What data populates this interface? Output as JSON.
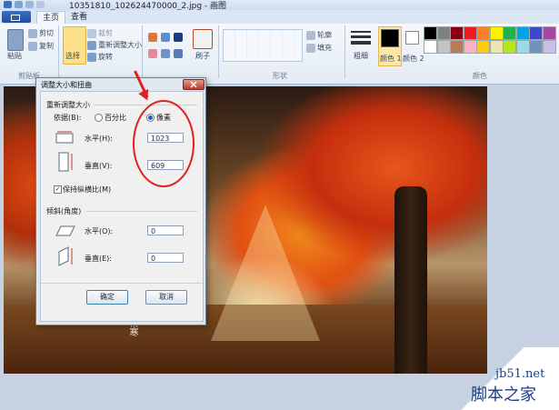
{
  "window": {
    "title": "10351810_102624470000_2.jpg - 画图"
  },
  "ribbon": {
    "tabs": [
      "主页",
      "查看"
    ],
    "clipboard": {
      "paste": "粘贴",
      "cut": "剪切",
      "copy": "复制",
      "group": "剪贴板"
    },
    "image": {
      "select": "选择",
      "crop": "裁剪",
      "resize": "重新调整大小",
      "rotate": "旋转"
    },
    "tools": {
      "brushes": "刷子"
    },
    "shapes": {
      "outline": "轮廓",
      "fill": "填充",
      "group": "形状"
    },
    "size": {
      "label": "粗细"
    },
    "colors": {
      "color1": "颜色 1",
      "color2": "颜色 2",
      "group": "颜色",
      "palette": [
        "#000000",
        "#7f7f7f",
        "#880015",
        "#ed1c24",
        "#ff7f27",
        "#fff200",
        "#22b14c",
        "#00a2e8",
        "#3f48cc",
        "#a349a4",
        "#ffffff",
        "#c3c3c3",
        "#b97a57",
        "#ffaec9",
        "#ffc90e",
        "#efe4b0",
        "#b5e61d",
        "#99d9ea",
        "#7092be",
        "#c8bfe7"
      ]
    }
  },
  "dialog": {
    "title": "调整大小和扭曲",
    "resize_section": "重新调整大小",
    "basis_label": "依据(B):",
    "percent_label": "百分比",
    "pixels_label": "像素",
    "horizontal_label": "水平(H):",
    "horizontal_value": "1023",
    "vertical_label": "垂直(V):",
    "vertical_value": "609",
    "keep_ratio_label": "保持纵横比(M)",
    "skew_section": "倾斜(角度)",
    "skew_horizontal_label": "水平(O):",
    "skew_horizontal_value": "0",
    "skew_vertical_label": "垂直(E):",
    "skew_vertical_value": "0",
    "ok": "确定",
    "cancel": "取消"
  },
  "photo": {
    "caption": "杨寒"
  },
  "watermark": {
    "domain": "jb51.net",
    "name": "脚本之家"
  }
}
